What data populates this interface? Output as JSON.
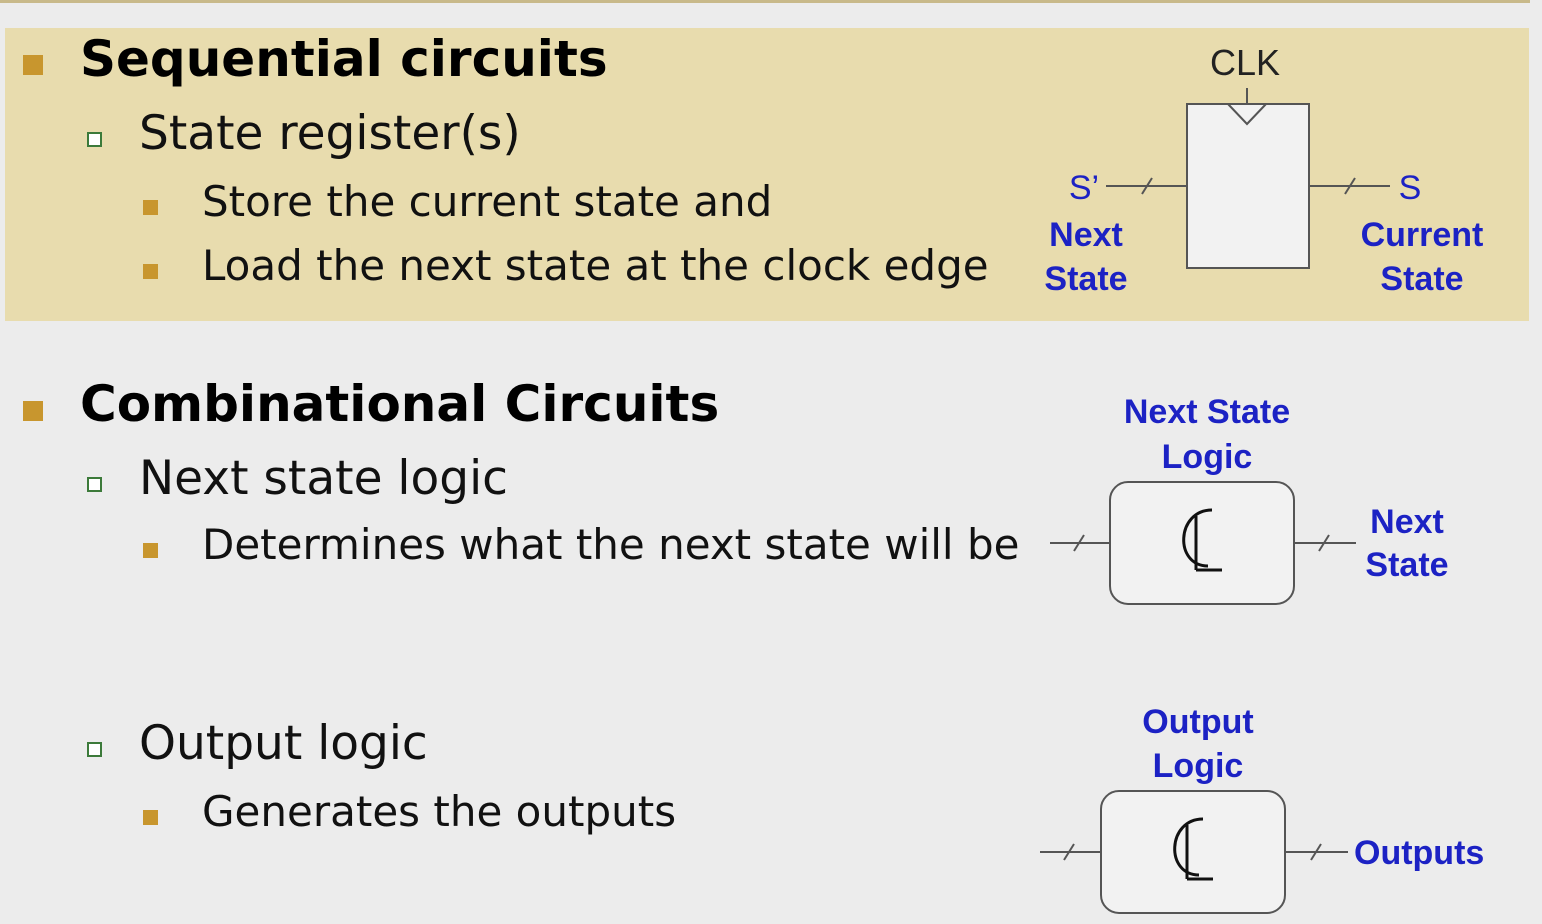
{
  "sections": {
    "sequential": {
      "heading": "Sequential circuits",
      "subheading": "State register(s)",
      "points": [
        "Store the current state and",
        "Load the next state at the clock edge"
      ]
    },
    "combinational": {
      "heading": "Combinational Circuits",
      "next_state_logic": {
        "subheading": "Next state logic",
        "points": [
          "Determines what the next state will be"
        ]
      },
      "output_logic": {
        "subheading": "Output logic",
        "points": [
          "Generates the outputs"
        ]
      }
    }
  },
  "diagrams": {
    "register": {
      "clock_label": "CLK",
      "input_label": "S’",
      "input_caption_1": "Next",
      "input_caption_2": "State",
      "output_label": "S",
      "output_caption_1": "Current",
      "output_caption_2": "State"
    },
    "next_state_block": {
      "title_1": "Next State",
      "title_2": "Logic",
      "symbol": "CL",
      "output_caption_1": "Next",
      "output_caption_2": "State"
    },
    "output_block": {
      "title_1": "Output",
      "title_2": "Logic",
      "symbol": "CL",
      "output_caption": "Outputs"
    }
  },
  "colors": {
    "highlight_band": "#e8dcae",
    "bullet_square": "#c8962e",
    "bullet_outline": "#3c7a3a",
    "diagram_label_blue": "#1c22c4",
    "diagram_line": "#555555"
  }
}
